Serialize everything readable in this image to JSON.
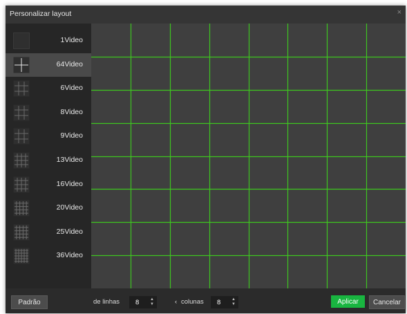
{
  "dialog": {
    "title": "Personalizar layout",
    "close_glyph": "×"
  },
  "sidebar": {
    "items": [
      {
        "label": "1Video",
        "icon": "layout-1-icon",
        "selected": false
      },
      {
        "label": "64Video",
        "icon": "layout-4-icon",
        "selected": true
      },
      {
        "label": "6Video",
        "icon": "layout-6-icon",
        "selected": false
      },
      {
        "label": "8Video",
        "icon": "layout-8-icon",
        "selected": false
      },
      {
        "label": "9Video",
        "icon": "layout-9-icon",
        "selected": false
      },
      {
        "label": "13Video",
        "icon": "layout-13-icon",
        "selected": false
      },
      {
        "label": "16Video",
        "icon": "layout-16-icon",
        "selected": false
      },
      {
        "label": "20Video",
        "icon": "layout-20-icon",
        "selected": false
      },
      {
        "label": "25Video",
        "icon": "layout-25-icon",
        "selected": false
      },
      {
        "label": "36Video",
        "icon": "layout-36-icon",
        "selected": false
      }
    ]
  },
  "grid": {
    "rows": 8,
    "cols": 8,
    "line_color": "#3ec61f",
    "cell_color": "#3f3f3f"
  },
  "footer": {
    "default_button": "Padrão",
    "rows_label": "de linhas",
    "rows_value": "8",
    "cols_label": "colunas",
    "cols_prefix": "‹",
    "cols_value": "8",
    "spin_glyph": "⬍",
    "apply_button": "Aplicar",
    "cancel_button": "Cancelar"
  },
  "colors": {
    "accent": "#19b540",
    "background": "#2b2b2b"
  }
}
